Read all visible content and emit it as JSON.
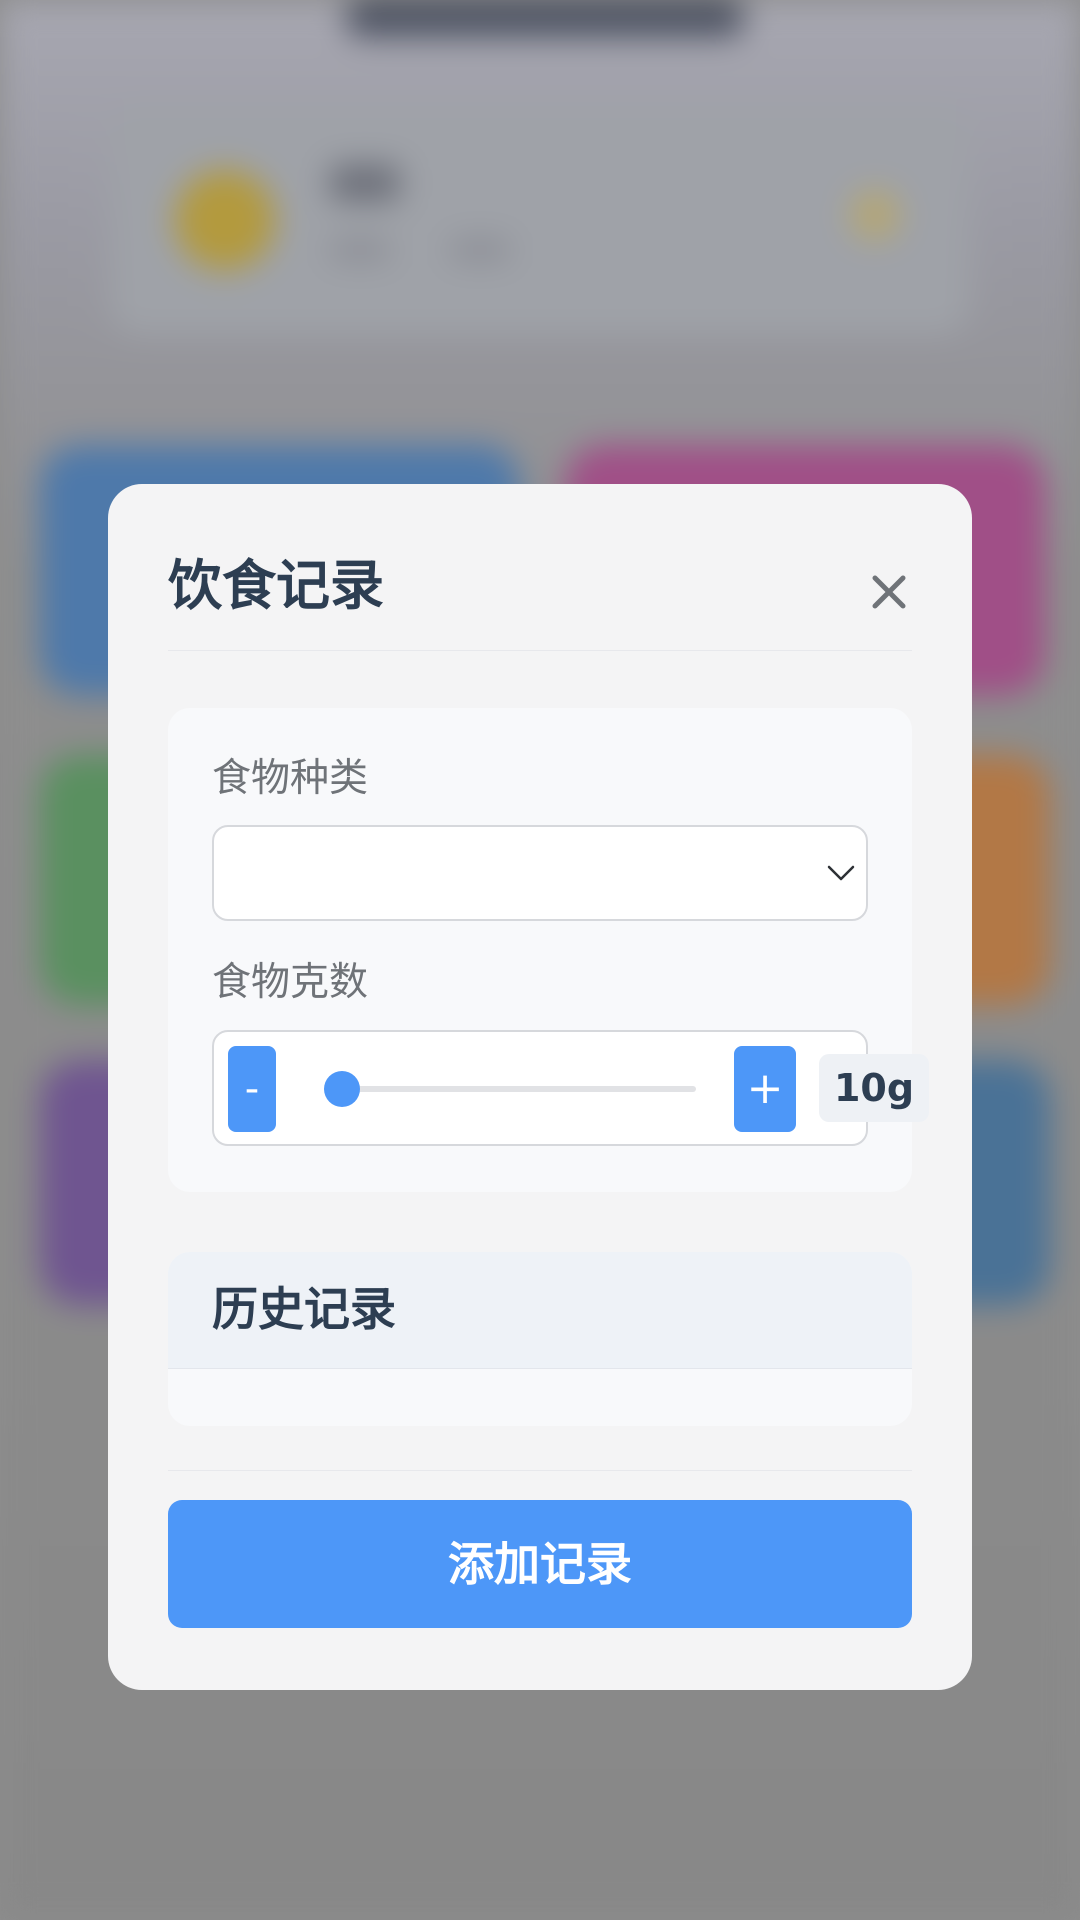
{
  "modal": {
    "title": "饮食记录",
    "close_icon": "close-icon"
  },
  "form": {
    "food_type": {
      "label": "食物种类",
      "value": "",
      "icon": "chevron-down-icon"
    },
    "food_grams": {
      "label": "食物克数",
      "minus_label": "-",
      "plus_label": "+",
      "slider_fraction": 0.0,
      "value_label": "10g"
    }
  },
  "history": {
    "title": "历史记录"
  },
  "actions": {
    "submit_label": "添加记录"
  },
  "colors": {
    "accent": "#4d97f8",
    "title_text": "#2d3e52",
    "label_text": "#6f7378",
    "modal_bg": "#f4f4f5",
    "overlay": "#8d8d8d"
  }
}
